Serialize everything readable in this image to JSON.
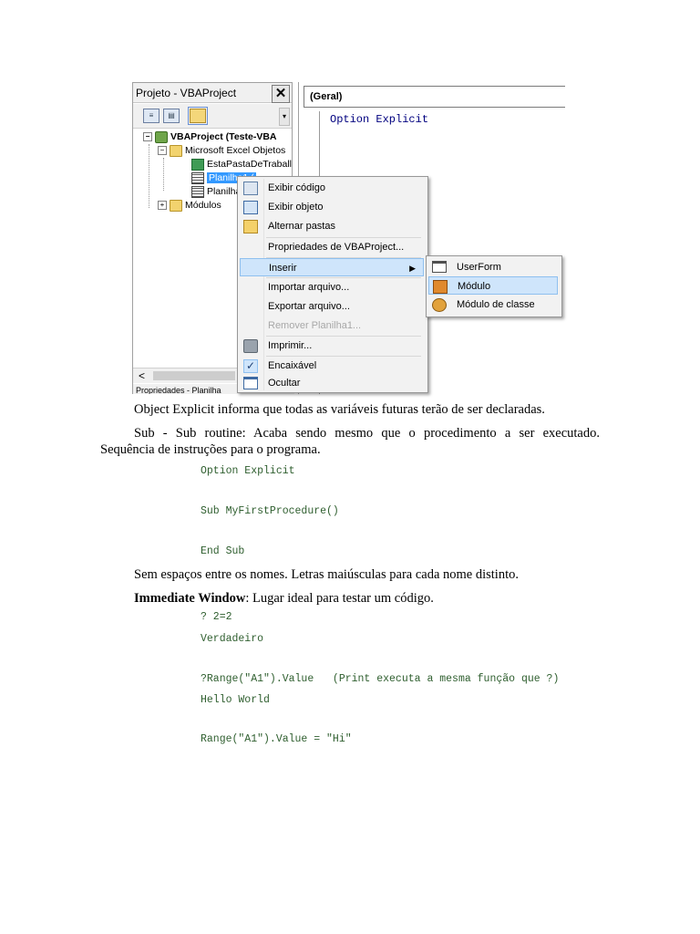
{
  "vbe": {
    "project_panel": {
      "title": "Projeto - VBAProject",
      "close_glyph": "✕",
      "tree": {
        "project": "VBAProject (Teste-VBA",
        "folder_objects": "Microsoft Excel Objetos",
        "workbook": "EstaPastaDeTraball",
        "sheet_selected": "Planilha1 (",
        "sheet_2": "Planilha",
        "folder_modules": "Módulos"
      },
      "hscroll_left": "<",
      "properties_title": "Propriedades - Planilha"
    },
    "code_window": {
      "object_combo": "(Geral)",
      "code_line": "Option Explicit"
    },
    "context_menu": {
      "items": [
        {
          "label": "Exibir código",
          "icon": "view-code-icon"
        },
        {
          "label": "Exibir objeto",
          "icon": "view-object-icon"
        },
        {
          "label": "Alternar pastas",
          "icon": "toggle-folders-icon"
        },
        {
          "label": "Propriedades de VBAProject...",
          "icon": ""
        },
        {
          "label": "Inserir",
          "icon": "",
          "highlighted": true,
          "submenu_arrow": "▶"
        },
        {
          "label": "Importar arquivo...",
          "icon": ""
        },
        {
          "label": "Exportar arquivo...",
          "icon": ""
        },
        {
          "label": "Remover Planilha1...",
          "icon": "",
          "disabled": true
        },
        {
          "label": "Imprimir...",
          "icon": "printer-icon"
        },
        {
          "label": "Encaixável",
          "icon": "checkmark-icon",
          "checked": true
        },
        {
          "label": "Ocultar",
          "icon": "window-icon"
        }
      ],
      "check_glyph": "✓"
    },
    "insert_submenu": {
      "items": [
        {
          "label": "UserForm",
          "icon": "userform-icon"
        },
        {
          "label": "Módulo",
          "icon": "module-icon",
          "highlighted": true
        },
        {
          "label": "Módulo de classe",
          "icon": "class-module-icon"
        }
      ]
    }
  },
  "document": {
    "para1": "Object Explicit informa que todas as variáveis futuras terão de ser declaradas.",
    "para2_line1": "Sub - Sub routine: Acaba sendo mesmo que o procedimento a ser executado.",
    "para2_line2": "Sequência de instruções para o programa.",
    "code1": [
      "Option Explicit",
      "Sub MyFirstProcedure()",
      "End Sub"
    ],
    "para3": "Sem espaços entre os nomes. Letras maiúsculas para cada nome distinto.",
    "para4_bold": "Immediate Window",
    "para4_rest": ": Lugar ideal para testar um código.",
    "code2": [
      "? 2=2",
      "Verdadeiro",
      "?Range(\"A1\").Value   (Print executa a mesma função que ?)",
      "Hello World",
      "Range(\"A1\").Value = \"Hi\""
    ]
  },
  "colors": {
    "menu_highlight": "#cfe5fb",
    "tree_selection": "#3399ff",
    "code_blue": "#00007f",
    "doc_code_green": "#2e5e2e"
  }
}
